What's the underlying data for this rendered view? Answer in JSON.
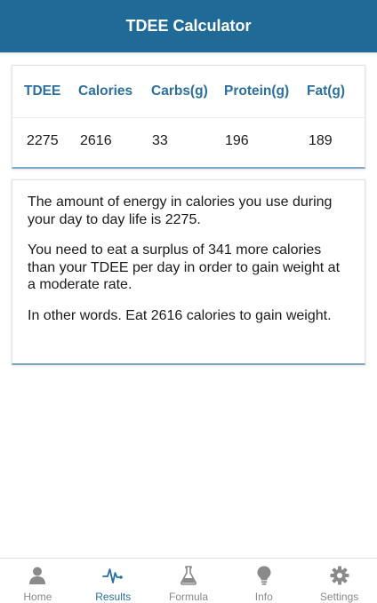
{
  "header": {
    "title": "TDEE Calculator"
  },
  "macros_table": {
    "headers": [
      "TDEE",
      "Calories",
      "Carbs(g)",
      "Protein(g)",
      "Fat(g)"
    ],
    "values": [
      "2275",
      "2616",
      "33",
      "196",
      "189"
    ]
  },
  "summary": {
    "paragraphs": [
      "The amount of energy in calories you use during your day to day life is 2275.",
      "You need to eat a surplus of 341 more calories than your TDEE per day in order to gain weight at a moderate rate.",
      "In other words. Eat 2616 calories to gain weight."
    ]
  },
  "bottom_nav": {
    "items": [
      {
        "label": "Home",
        "icon": "person-icon",
        "active": false
      },
      {
        "label": "Results",
        "icon": "pulse-icon",
        "active": true
      },
      {
        "label": "Formula",
        "icon": "flask-icon",
        "active": false
      },
      {
        "label": "Info",
        "icon": "lightbulb-icon",
        "active": false
      },
      {
        "label": "Settings",
        "icon": "gear-icon",
        "active": false
      }
    ]
  },
  "colors": {
    "header_bg": "#1f6a96",
    "accent": "#2b6fa0",
    "inactive": "#8a8a8a"
  }
}
